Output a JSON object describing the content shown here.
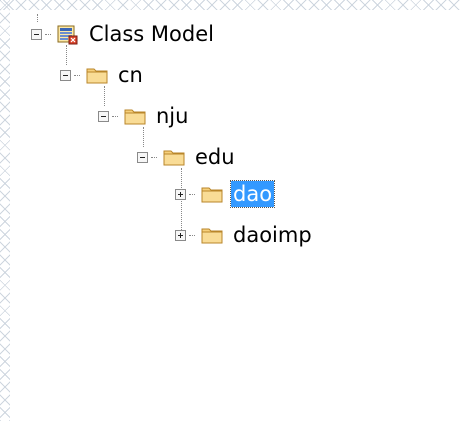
{
  "tree": {
    "root": {
      "label": "Class Model",
      "icon": "class-model-icon",
      "expanded": true
    },
    "nodes": [
      {
        "label": "cn",
        "icon": "folder-icon",
        "expanded": true,
        "selected": false
      },
      {
        "label": "nju",
        "icon": "folder-icon",
        "expanded": true,
        "selected": false
      },
      {
        "label": "edu",
        "icon": "folder-icon",
        "expanded": true,
        "selected": false
      },
      {
        "label": "dao",
        "icon": "folder-icon",
        "expanded": false,
        "selected": true
      },
      {
        "label": "daoimp",
        "icon": "folder-icon",
        "expanded": false,
        "selected": false
      }
    ]
  },
  "colors": {
    "selection": "#3399ff",
    "folder_fill": "#f6d07c",
    "folder_stroke": "#b9862a"
  }
}
